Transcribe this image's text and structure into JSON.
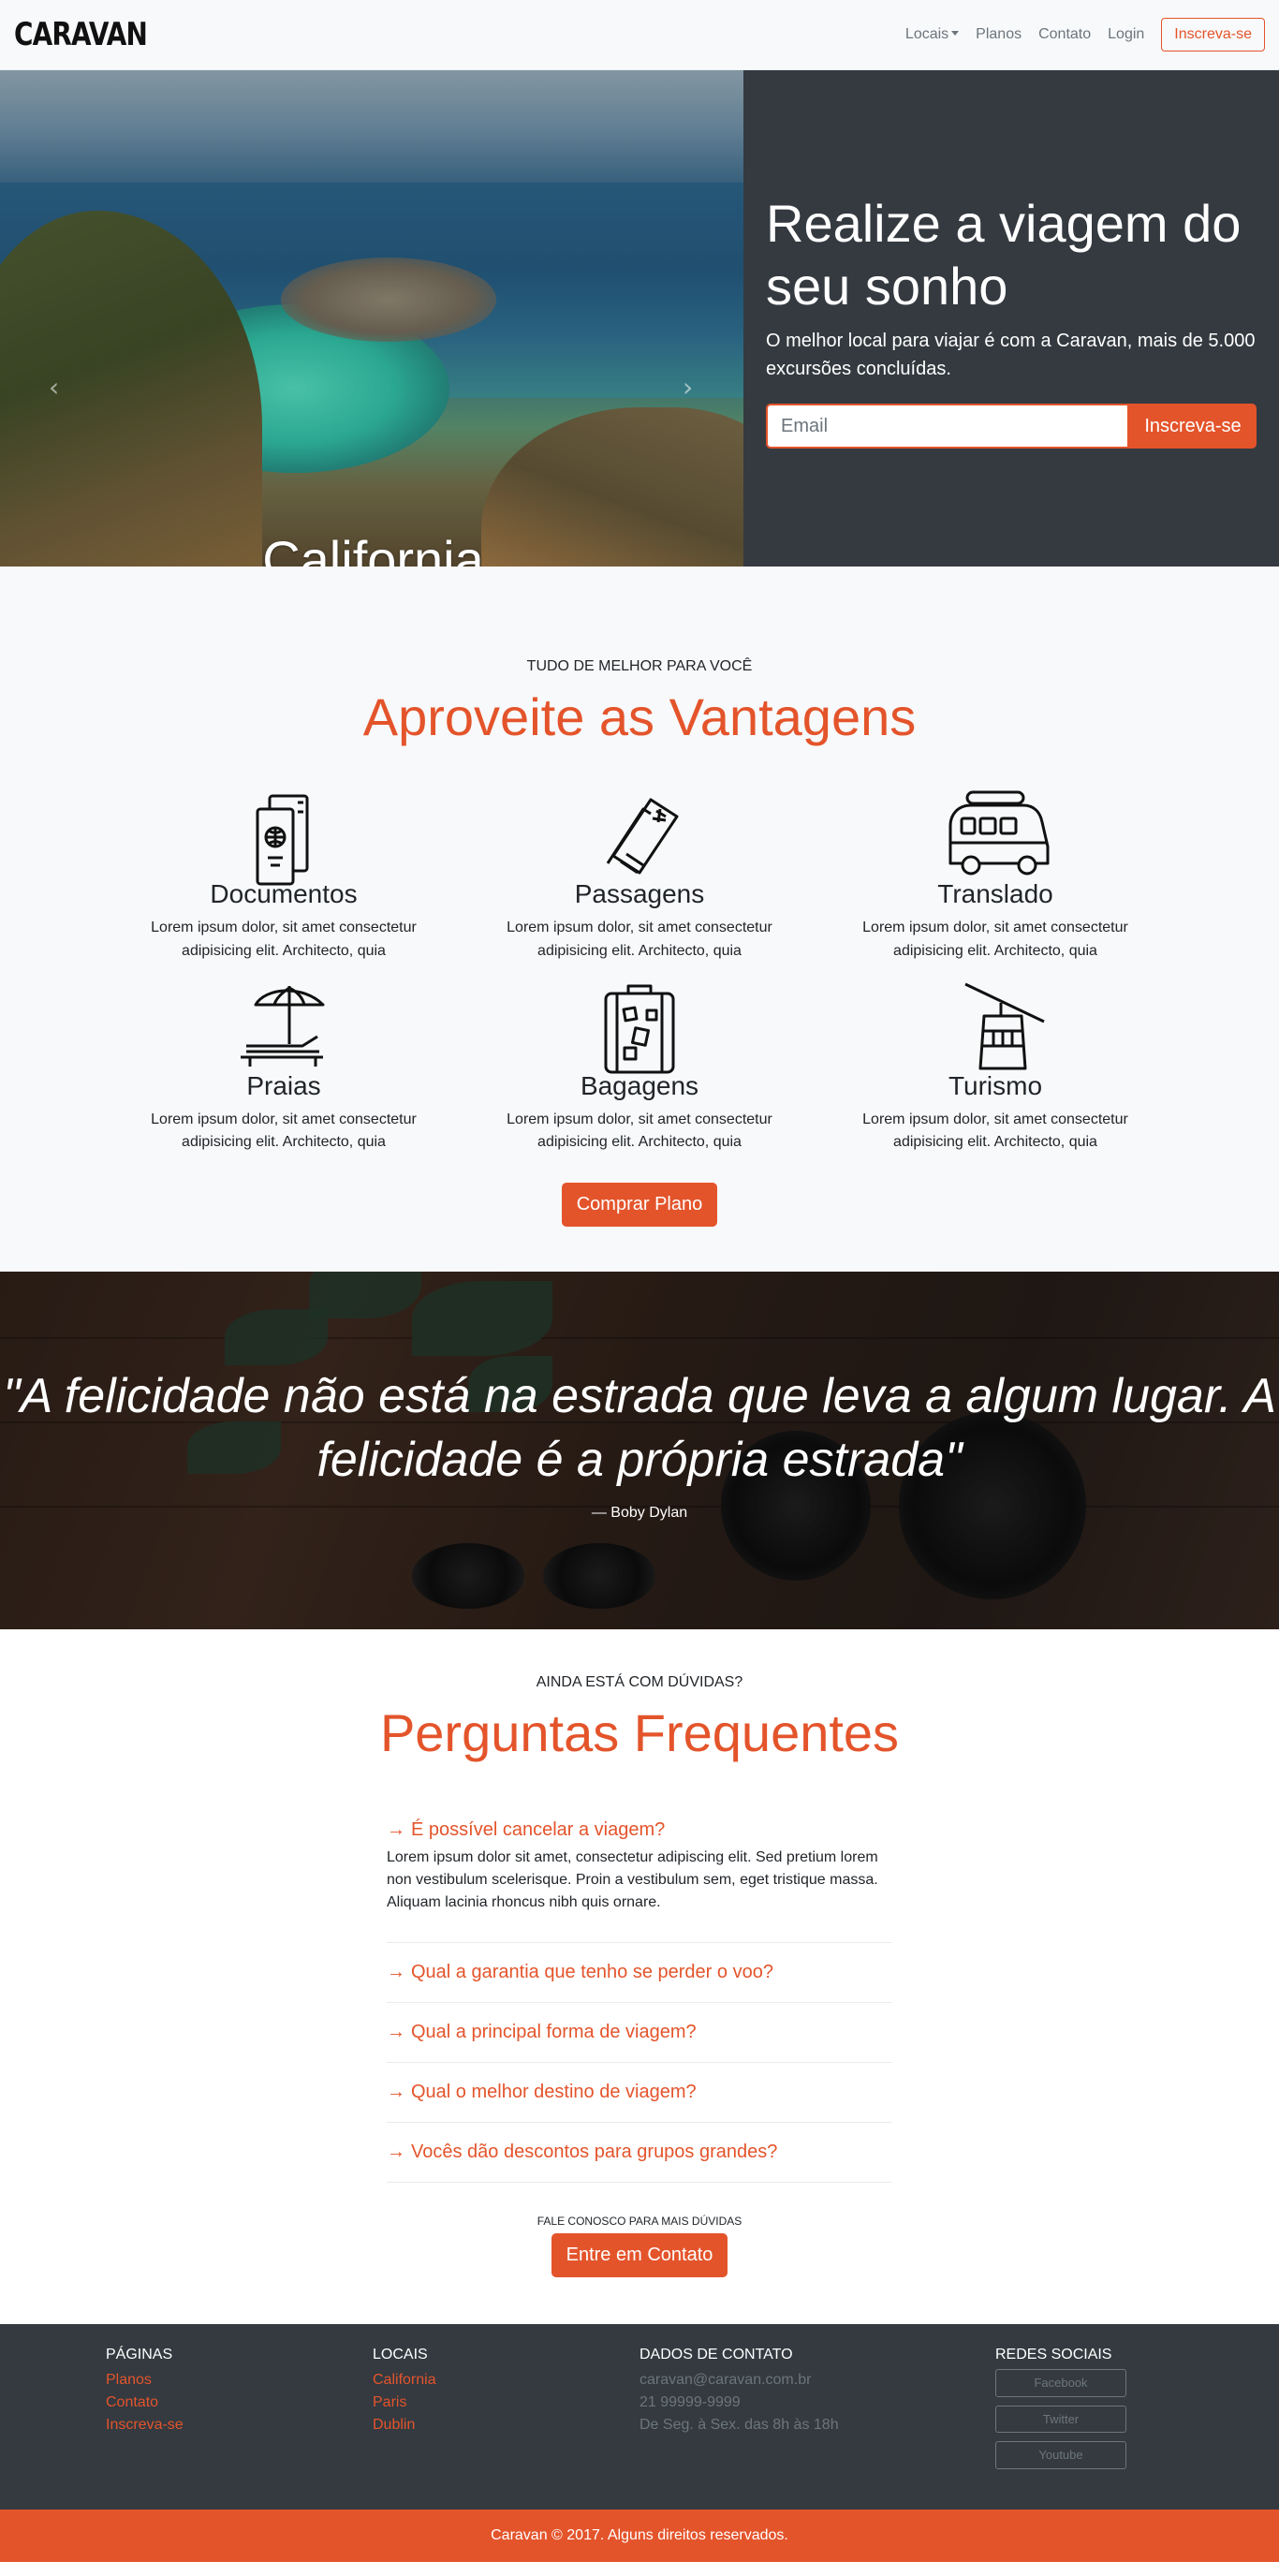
{
  "brand": "CARAVAN",
  "nav": {
    "locais": "Locais",
    "planos": "Planos",
    "contato": "Contato",
    "login": "Login",
    "signup": "Inscreva-se"
  },
  "hero": {
    "caption": "California",
    "title": "Realize a viagem do seu sonho",
    "subtitle": "O melhor local para viajar é com a Caravan, mais de 5.000 excursões concluídas.",
    "email_placeholder": "Email",
    "button": "Inscreva-se"
  },
  "features": {
    "eyebrow": "TUDO DE MELHOR PARA VOCÊ",
    "title": "Aproveite as Vantagens",
    "items": [
      {
        "icon": "passport-icon",
        "title": "Documentos",
        "text": "Lorem ipsum dolor, sit amet consectetur adipisicing elit. Architecto, quia"
      },
      {
        "icon": "tickets-icon",
        "title": "Passagens",
        "text": "Lorem ipsum dolor, sit amet consectetur adipisicing elit. Architecto, quia"
      },
      {
        "icon": "van-icon",
        "title": "Translado",
        "text": "Lorem ipsum dolor, sit amet consectetur adipisicing elit. Architecto, quia"
      },
      {
        "icon": "beach-chair-icon",
        "title": "Praias",
        "text": "Lorem ipsum dolor, sit amet consectetur adipisicing elit. Architecto, quia"
      },
      {
        "icon": "suitcase-icon",
        "title": "Bagagens",
        "text": "Lorem ipsum dolor, sit amet consectetur adipisicing elit. Architecto, quia"
      },
      {
        "icon": "cable-car-icon",
        "title": "Turismo",
        "text": "Lorem ipsum dolor, sit amet consectetur adipisicing elit. Architecto, quia"
      }
    ],
    "button": "Comprar Plano"
  },
  "quote": {
    "text": "\"A felicidade não está na estrada que leva a algum lugar. A felicidade é a própria estrada\"",
    "author": "— Boby Dylan"
  },
  "faq": {
    "eyebrow": "AINDA ESTÁ COM DÚVIDAS?",
    "title": "Perguntas Frequentes",
    "items": [
      {
        "q": "É possível cancelar a viagem?",
        "a": "Lorem ipsum dolor sit amet, consectetur adipiscing elit. Sed pretium lorem non vestibulum scelerisque. Proin a vestibulum sem, eget tristique massa. Aliquam lacinia rhoncus nibh quis ornare."
      },
      {
        "q": "Qual a garantia que tenho se perder o voo?",
        "a": ""
      },
      {
        "q": "Qual a principal forma de viagem?",
        "a": ""
      },
      {
        "q": "Qual o melhor destino de viagem?",
        "a": ""
      },
      {
        "q": "Vocês dão descontos para grupos grandes?",
        "a": ""
      }
    ],
    "contact_small": "FALE CONOSCO PARA MAIS DÚVIDAS",
    "contact_button": "Entre em Contato"
  },
  "footer": {
    "pages_title": "PÁGINAS",
    "pages": [
      "Planos",
      "Contato",
      "Inscreva-se"
    ],
    "locations_title": "LOCAIS",
    "locations": [
      "California",
      "Paris",
      "Dublin"
    ],
    "contact_title": "DADOS DE CONTATO",
    "contact": [
      "caravan@caravan.com.br",
      "21 99999-9999",
      "De Seg. à Sex. das 8h às 18h"
    ],
    "social_title": "REDES SOCIAIS",
    "social": [
      "Facebook",
      "Twitter",
      "Youtube"
    ],
    "copyright": "Caravan © 2017. Alguns direitos reservados."
  },
  "colors": {
    "accent": "#e4542b",
    "dark": "#343a40",
    "light": "#f8f9fa"
  }
}
